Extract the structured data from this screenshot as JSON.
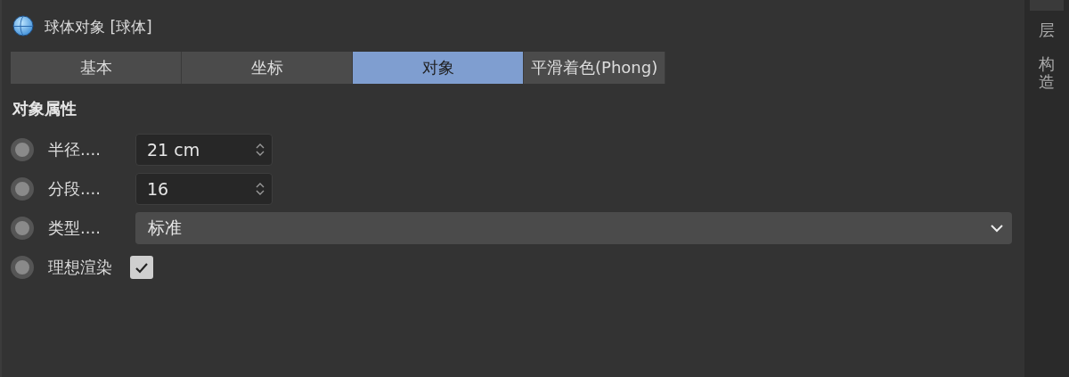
{
  "header": {
    "title": "球体对象 [球体]"
  },
  "tabs": [
    {
      "label": "基本",
      "selected": false
    },
    {
      "label": "坐标",
      "selected": false
    },
    {
      "label": "对象",
      "selected": true
    },
    {
      "label": "平滑着色(Phong)",
      "selected": false
    }
  ],
  "section": {
    "title": "对象属性"
  },
  "params": [
    {
      "kind": "number",
      "label": "半径....",
      "value": "21 cm",
      "keyframed": false
    },
    {
      "kind": "number",
      "label": "分段....",
      "value": "16",
      "keyframed": false
    },
    {
      "kind": "dropdown",
      "label": "类型....",
      "value": "标准",
      "keyframed": false
    },
    {
      "kind": "checkbox",
      "label": "理想渲染",
      "checked": true,
      "keyframed": false
    }
  ],
  "side_tabs": [
    {
      "selected": true
    },
    {
      "label": "层",
      "selected": false
    },
    {
      "label": "构造",
      "selected": false
    }
  ]
}
